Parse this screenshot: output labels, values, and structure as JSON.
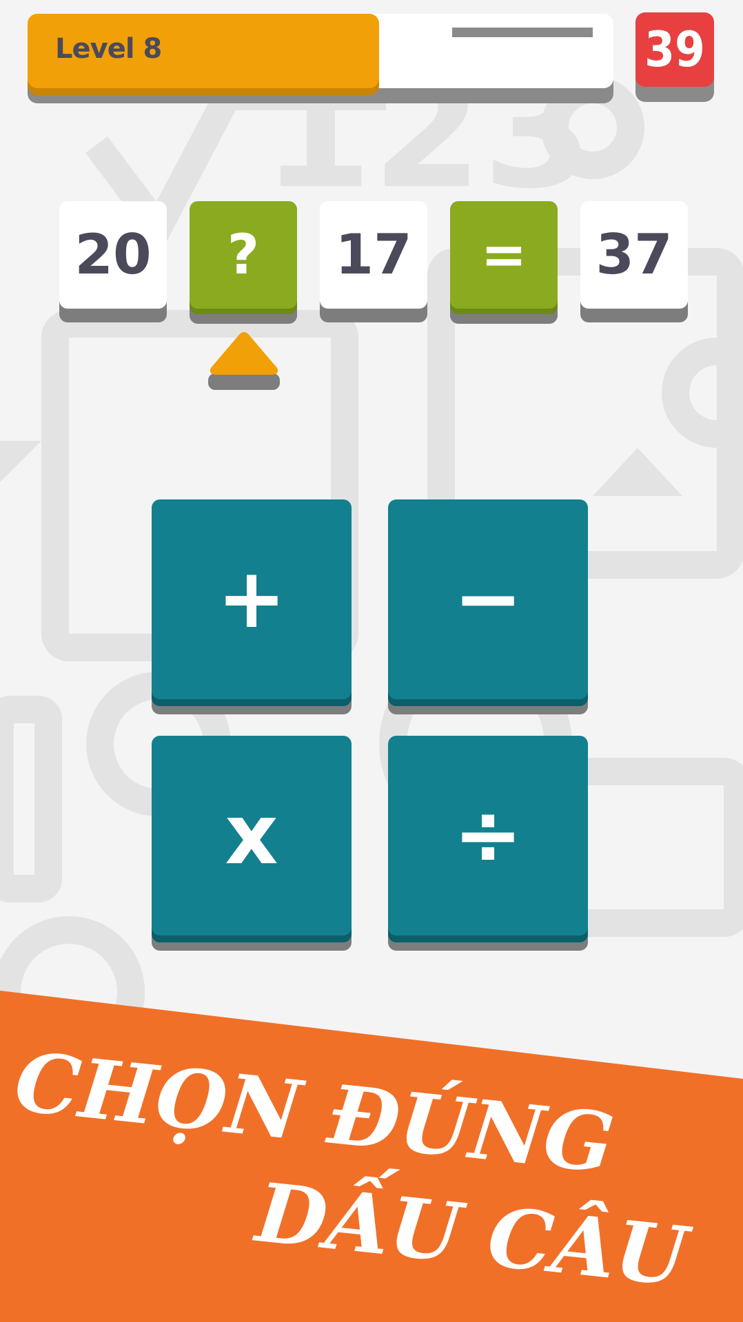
{
  "header": {
    "level_label": "Level 8",
    "progress": 0.6,
    "timer": "39"
  },
  "equation": {
    "left_operand": "20",
    "operator_slot": "?",
    "right_operand": "17",
    "equals": "=",
    "result": "37"
  },
  "operators": [
    {
      "symbol": "+"
    },
    {
      "symbol": "−"
    },
    {
      "symbol": "x"
    },
    {
      "symbol": "÷"
    }
  ],
  "banner": {
    "line1": "CHỌN ĐÚNG",
    "line2": "DẤU CÂU"
  },
  "colors": {
    "progress": "#f2a007",
    "timer": "#e84040",
    "operator_tile": "#8aab1f",
    "operator_button": "#12808e",
    "banner": "#f07028"
  }
}
